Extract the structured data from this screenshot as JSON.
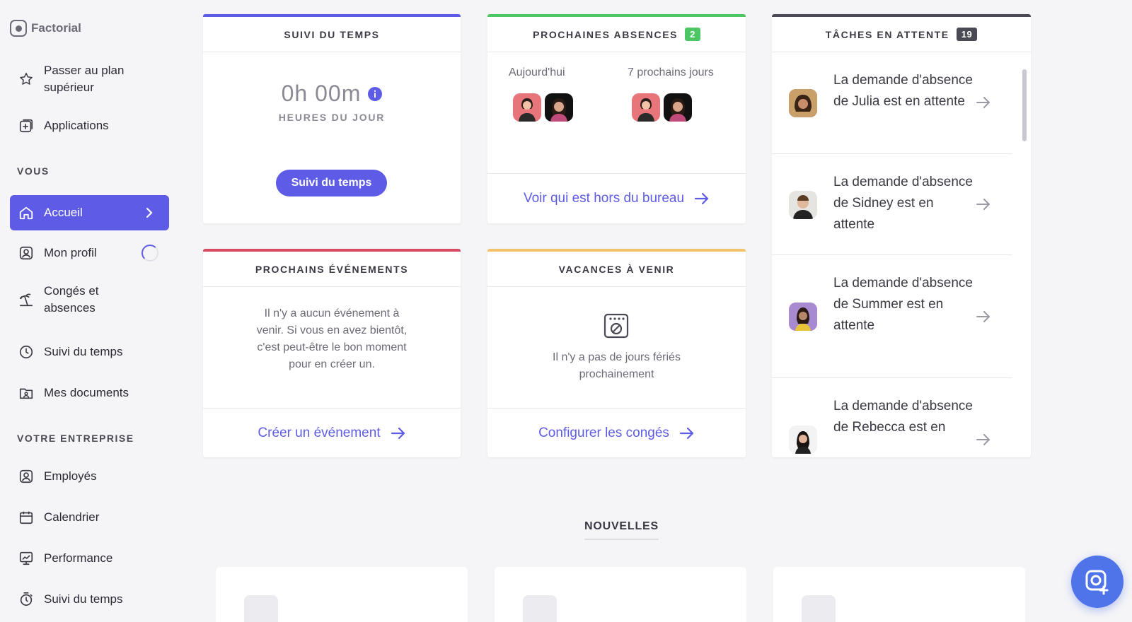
{
  "brand": {
    "name": "Factorial"
  },
  "sidebar": {
    "upgrade_label": "Passer au plan supérieur",
    "applications_label": "Applications",
    "section_you": "VOUS",
    "items_you": [
      {
        "label": "Accueil",
        "icon": "home-icon",
        "active": true
      },
      {
        "label": "Mon profil",
        "icon": "profile-icon"
      },
      {
        "label": "Congés et absences",
        "icon": "beach-icon"
      },
      {
        "label": "Suivi du temps",
        "icon": "clock-icon"
      },
      {
        "label": "Mes documents",
        "icon": "folder-icon"
      }
    ],
    "section_company": "VOTRE ENTREPRISE",
    "items_company": [
      {
        "label": "Employés",
        "icon": "employees-icon"
      },
      {
        "label": "Calendrier",
        "icon": "calendar-icon"
      },
      {
        "label": "Performance",
        "icon": "performance-icon"
      },
      {
        "label": "Suivi du temps",
        "icon": "stopwatch-icon"
      }
    ]
  },
  "cards": {
    "time_tracking": {
      "title": "SUIVI DU TEMPS",
      "accent": "#5e5ce6",
      "hours": "0h 00m",
      "hours_caption": "HEURES DU JOUR",
      "button": "Suivi du temps"
    },
    "absences": {
      "title": "PROCHAINES ABSENCES",
      "badge": "2",
      "accent": "#4cc763",
      "today_label": "Aujourd'hui",
      "next_label": "7 prochains jours",
      "link": "Voir qui est hors du bureau"
    },
    "tasks": {
      "title": "TÂCHES EN ATTENTE",
      "badge": "19",
      "accent": "#4a4a55",
      "items": [
        {
          "text": "La demande d'absence de Julia est en attente"
        },
        {
          "text": "La demande d'absence de Sidney est en attente"
        },
        {
          "text": "La demande d'absence de Summer est en attente"
        },
        {
          "text": "La demande d'absence de Rebecca est en"
        }
      ]
    },
    "events": {
      "title": "PROCHAINS ÉVÉNEMENTS",
      "accent": "#d94a63",
      "empty_text": "Il n'y a aucun événement à venir. Si vous en avez bientôt, c'est peut-être le bon moment pour en créer un.",
      "link": "Créer un événement"
    },
    "holidays": {
      "title": "VACANCES À VENIR",
      "accent": "#f2c36b",
      "empty_text": "Il n'y a pas de jours fériés prochainement",
      "link": "Configurer les congés"
    }
  },
  "news": {
    "title": "NOUVELLES"
  }
}
